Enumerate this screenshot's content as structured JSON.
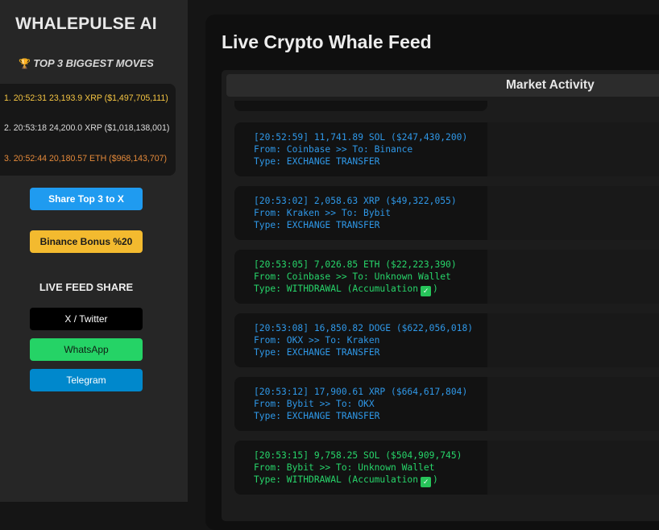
{
  "sidebar": {
    "brand": "WHALEPULSE AI",
    "top3_title": "TOP 3 BIGGEST MOVES",
    "top3_icon": "trophy-icon",
    "top_moves": [
      "1. 20:52:31 23,193.9 XRP ($1,497,705,111)",
      "2. 20:53:18 24,200.0 XRP ($1,018,138,001)",
      "3. 20:52:44 20,180.57 ETH ($968,143,707)"
    ],
    "share_button": "Share Top 3 to X",
    "binance_button": "Binance Bonus %20",
    "live_feed_title": "LIVE FEED SHARE",
    "share_buttons": {
      "twitter": "X / Twitter",
      "whatsapp": "WhatsApp",
      "telegram": "Telegram"
    }
  },
  "main": {
    "title": "Live Crypto Whale Feed",
    "market_header": "Market Activity",
    "feed": [
      {
        "l1": "[20:52:59] 11,741.89 SOL ($247,430,200)",
        "l2": "From: Coinbase >> To: Binance",
        "l3": "Type: EXCHANGE TRANSFER",
        "color": "#2f98e8"
      },
      {
        "l1": "[20:53:02] 2,058.63 XRP ($49,322,055)",
        "l2": "From: Kraken >> To: Bybit",
        "l3": "Type: EXCHANGE TRANSFER",
        "color": "#2f98e8"
      },
      {
        "l1": "[20:53:05] 7,026.85 ETH ($22,223,390)",
        "l2": "From: Coinbase >> To: Unknown Wallet",
        "l3a": "Type: WITHDRAWAL (Accumulation",
        "l3b": ")",
        "color": "#27d56a"
      },
      {
        "l1": "[20:53:08] 16,850.82 DOGE ($622,056,018)",
        "l2": "From: OKX >> To: Kraken",
        "l3": "Type: EXCHANGE TRANSFER",
        "color": "#2f98e8"
      },
      {
        "l1": "[20:53:12] 17,900.61 XRP ($664,617,804)",
        "l2": "From: Bybit >> To: OKX",
        "l3": "Type: EXCHANGE TRANSFER",
        "color": "#2f98e8"
      },
      {
        "l1": "[20:53:15] 9,758.25 SOL ($504,909,745)",
        "l2": "From: Bybit >> To: Unknown Wallet",
        "l3a": "Type: WITHDRAWAL (Accumulation",
        "l3b": ")",
        "color": "#27d56a"
      }
    ]
  }
}
